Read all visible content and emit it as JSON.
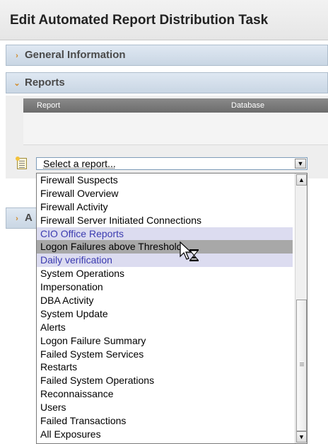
{
  "page": {
    "title": "Edit Automated Report Distribution Task"
  },
  "sections": {
    "general": {
      "label": "General Information"
    },
    "reports": {
      "label": "Reports"
    },
    "third": {
      "label": "A"
    }
  },
  "reports_grid": {
    "columns": [
      "Report",
      "Database"
    ]
  },
  "report_select": {
    "value": "Select a report..."
  },
  "dropdown": {
    "items": [
      "Firewall Suspects",
      "Firewall Overview",
      "Firewall Activity",
      "Firewall Server Initiated Connections",
      "CIO Office Reports",
      "Logon Failures above Threshold",
      "Daily verification",
      "System Operations",
      "Impersonation",
      "DBA Activity",
      "System Update",
      "Alerts",
      "Logon Failure Summary",
      "Failed System Services",
      "Restarts",
      "Failed System Operations",
      "Reconnaissance",
      "Users",
      "Failed Transactions",
      "All Exposures"
    ]
  },
  "colors": {
    "group_item_bg": "#dcdcf0",
    "group_item_text": "#3b3bb0",
    "hover_item_bg": "#a8a8a8",
    "chevron": "#d08a2a"
  }
}
